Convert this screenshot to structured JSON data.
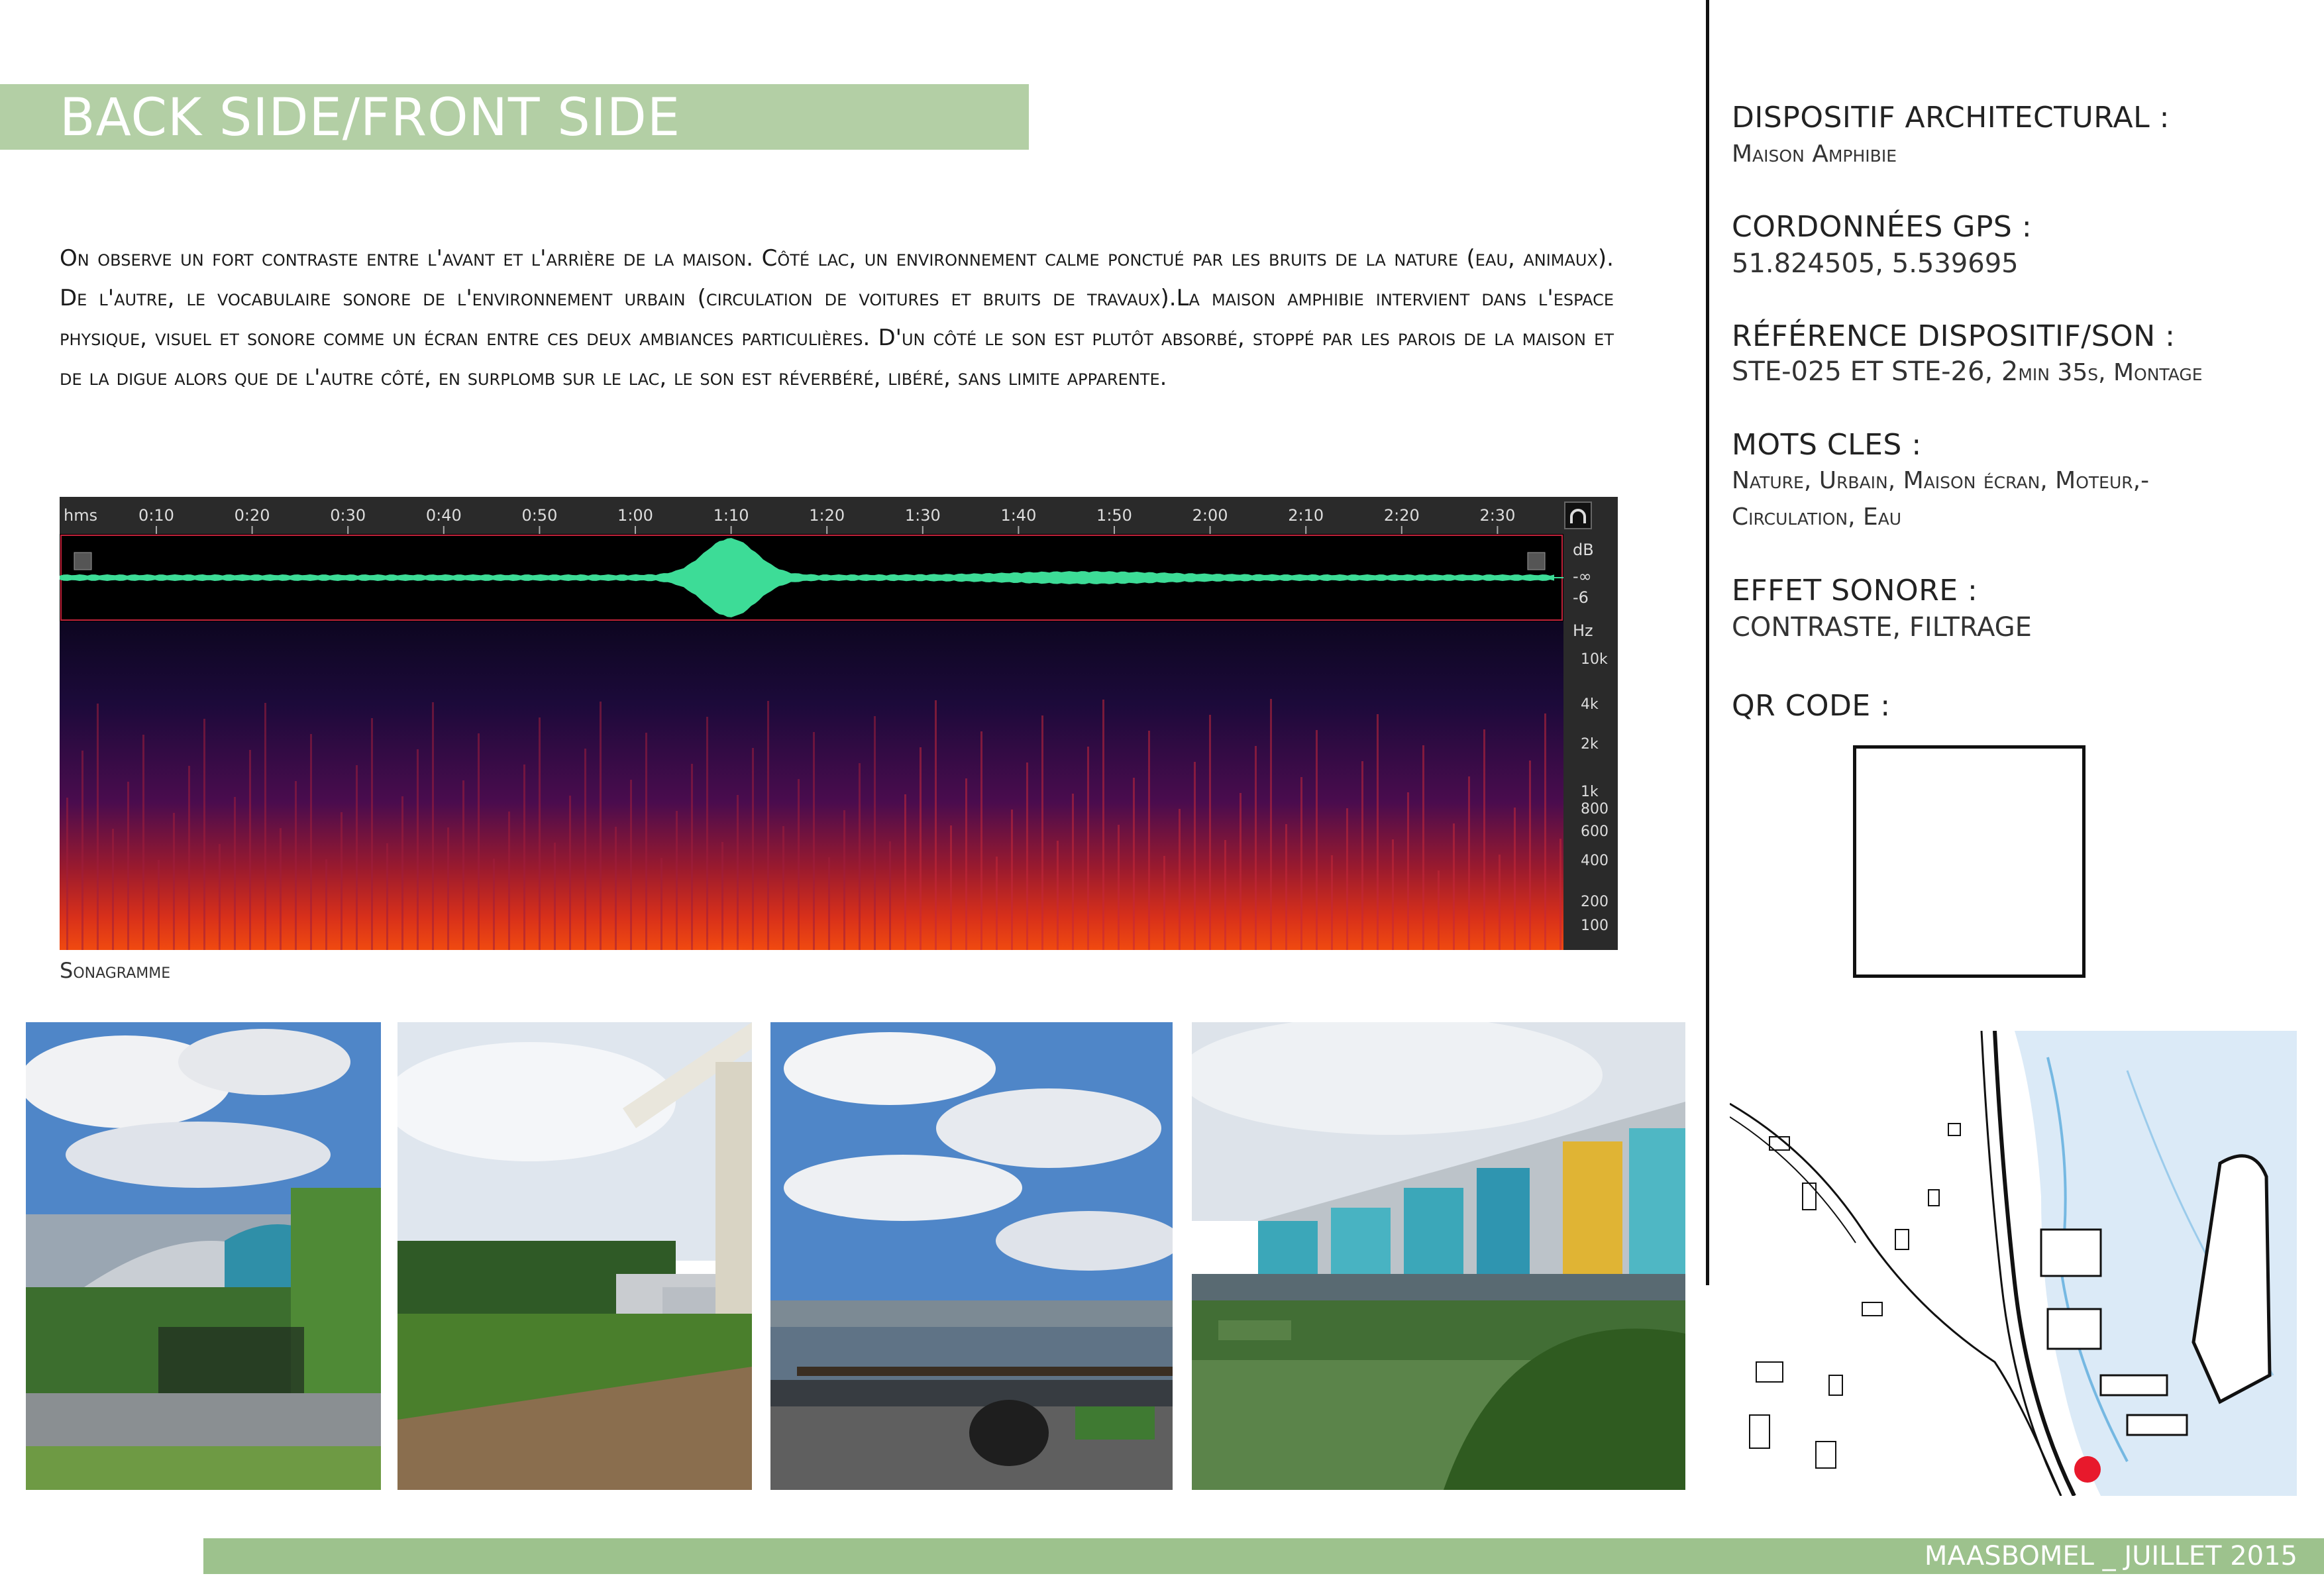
{
  "header": {
    "title": "BACK SIDE/FRONT SIDE"
  },
  "body": {
    "paragraph": "On observe un fort contraste entre l'avant et l'arrière de la maison. Côté lac, un environnement calme ponctué par les bruits de la nature (eau, animaux). De l'autre, le vocabulaire sonore de l'environnement urbain (circulation de voitures et bruits de travaux).La maison amphibie intervient dans l'espace physique, visuel et sonore comme un écran entre ces deux ambiances particulières. D'un côté le son est plutôt absorbé, stoppé par les parois de la maison et de la digue alors que de l'autre côté, en surplomb sur le lac, le son est réverbéré, libéré, sans limite apparente."
  },
  "sonagram": {
    "caption": "Sonagramme",
    "time_unit": "hms",
    "time_ticks": [
      "0:10",
      "0:20",
      "0:30",
      "0:40",
      "0:50",
      "1:00",
      "1:10",
      "1:20",
      "1:30",
      "1:40",
      "1:50",
      "2:00",
      "2:10",
      "2:20",
      "2:30"
    ],
    "db_label": "dB",
    "db_ticks": [
      "-∞",
      "-6"
    ],
    "hz_label": "Hz",
    "hz_ticks": [
      "10k",
      "4k",
      "2k",
      "1k",
      "800",
      "600",
      "400",
      "200",
      "100"
    ],
    "colors": {
      "waveform": "#3ddc97",
      "background": "#111111"
    }
  },
  "sidebar": {
    "dispositif_label": "DISPOSITIF ARCHITECTURAL :",
    "dispositif_value": "Maison Amphibie",
    "gps_label": "CORDONNÉES GPS :",
    "gps_value": "51.824505, 5.539695",
    "reference_label": "RÉFÉRENCE DISPOSITIF/SON :",
    "reference_value_main": "STE-025 ET STE-26, 2",
    "reference_value_sc": "min 35s, Montage",
    "mots_label": "MOTS CLES :",
    "mots_line1": "Nature, Urbain, Maison écran, Moteur,-",
    "mots_line2": "Circulation, Eau",
    "effet_label": "EFFET SONORE :",
    "effet_value": "CONTRASTE, FILTRAGE",
    "qr_label": "QR CODE :"
  },
  "footer": {
    "text": "MAASBOMEL _ JUILLET 2015"
  },
  "colors": {
    "accent_green": "#b3cfa5",
    "footer_green": "#9dc28d",
    "map_marker": "#e8192c"
  }
}
